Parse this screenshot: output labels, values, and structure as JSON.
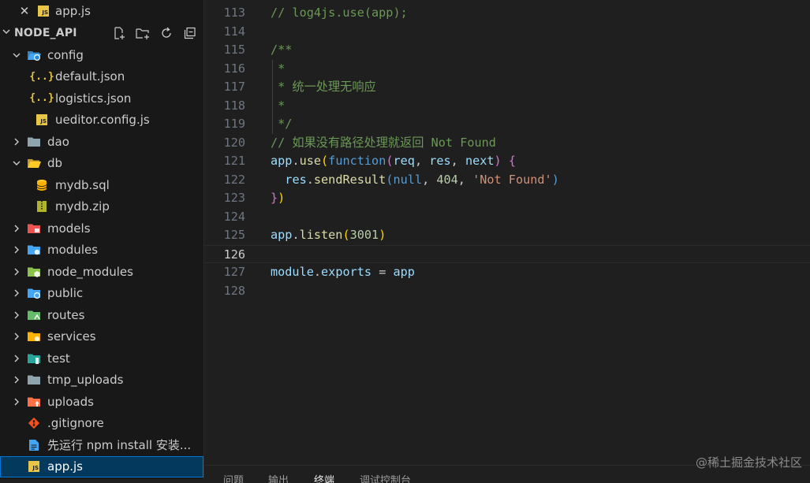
{
  "open_editor": {
    "close_glyph": "✕",
    "file_badge": "JS",
    "file_name": "app.js"
  },
  "explorer": {
    "title": "NODE_API",
    "actions": [
      "new-file-icon",
      "new-folder-icon",
      "refresh-icon",
      "collapse-all-icon"
    ]
  },
  "tree": [
    {
      "name": "config",
      "type": "folder",
      "expanded": true,
      "icon": "folder-config-icon",
      "color": "#42a5f5",
      "depth": 0
    },
    {
      "name": "default.json",
      "type": "file",
      "icon": "json-icon",
      "depth": 1
    },
    {
      "name": "logistics.json",
      "type": "file",
      "icon": "json-icon",
      "depth": 1
    },
    {
      "name": "ueditor.config.js",
      "type": "file",
      "icon": "js-icon",
      "depth": 1
    },
    {
      "name": "dao",
      "type": "folder",
      "expanded": false,
      "icon": "folder-icon",
      "color": "#90a4ae",
      "depth": 0
    },
    {
      "name": "db",
      "type": "folder",
      "expanded": true,
      "icon": "folder-db-icon",
      "color": "#ffca28",
      "depth": 0
    },
    {
      "name": "mydb.sql",
      "type": "file",
      "icon": "database-icon",
      "depth": 1
    },
    {
      "name": "mydb.zip",
      "type": "file",
      "icon": "zip-icon",
      "depth": 1
    },
    {
      "name": "models",
      "type": "folder",
      "expanded": false,
      "icon": "folder-models-icon",
      "color": "#ef5350",
      "depth": 0
    },
    {
      "name": "modules",
      "type": "folder",
      "expanded": false,
      "icon": "folder-modules-icon",
      "color": "#42a5f5",
      "depth": 0
    },
    {
      "name": "node_modules",
      "type": "folder",
      "expanded": false,
      "icon": "folder-node-icon",
      "color": "#8bc34a",
      "depth": 0
    },
    {
      "name": "public",
      "type": "folder",
      "expanded": false,
      "icon": "folder-public-icon",
      "color": "#42a5f5",
      "depth": 0
    },
    {
      "name": "routes",
      "type": "folder",
      "expanded": false,
      "icon": "folder-routes-icon",
      "color": "#66bb6a",
      "depth": 0
    },
    {
      "name": "services",
      "type": "folder",
      "expanded": false,
      "icon": "folder-services-icon",
      "color": "#ffb300",
      "depth": 0
    },
    {
      "name": "test",
      "type": "folder",
      "expanded": false,
      "icon": "folder-test-icon",
      "color": "#26a69a",
      "depth": 0
    },
    {
      "name": "tmp_uploads",
      "type": "folder",
      "expanded": false,
      "icon": "folder-icon",
      "color": "#90a4ae",
      "depth": 0
    },
    {
      "name": "uploads",
      "type": "folder",
      "expanded": false,
      "icon": "folder-uploads-icon",
      "color": "#ff7043",
      "depth": 0
    },
    {
      "name": ".gitignore",
      "type": "file",
      "icon": "git-icon",
      "depth": 0
    },
    {
      "name": "先运行 npm install 安装...",
      "type": "file",
      "icon": "document-icon",
      "depth": 0
    },
    {
      "name": "app.js",
      "type": "file",
      "icon": "js-icon",
      "depth": 0,
      "selected": true
    }
  ],
  "editor": {
    "lines": [
      {
        "n": "113",
        "tokens": [
          [
            "c-comment",
            "// log4js.use(app);"
          ]
        ]
      },
      {
        "n": "114",
        "tokens": []
      },
      {
        "n": "115",
        "tokens": [
          [
            "c-comment",
            "/**"
          ]
        ]
      },
      {
        "n": "116",
        "tokens": [
          [
            "c-comment",
            " *"
          ]
        ]
      },
      {
        "n": "117",
        "tokens": [
          [
            "c-comment",
            " * 统一处理无响应"
          ]
        ]
      },
      {
        "n": "118",
        "tokens": [
          [
            "c-comment",
            " *"
          ]
        ]
      },
      {
        "n": "119",
        "tokens": [
          [
            "c-comment",
            " */"
          ]
        ]
      },
      {
        "n": "120",
        "tokens": [
          [
            "c-comment",
            "// 如果没有路径处理就返回 Not Found"
          ]
        ]
      },
      {
        "n": "121",
        "tokens": [
          [
            "c-var",
            "app"
          ],
          [
            "c-punc",
            "."
          ],
          [
            "c-fn",
            "use"
          ],
          [
            "c-brace",
            "("
          ],
          [
            "c-kw",
            "function"
          ],
          [
            "c-paren",
            "("
          ],
          [
            "c-var",
            "req"
          ],
          [
            "c-punc",
            ", "
          ],
          [
            "c-var",
            "res"
          ],
          [
            "c-punc",
            ", "
          ],
          [
            "c-var",
            "next"
          ],
          [
            "c-paren",
            ")"
          ],
          [
            "c-punc",
            " "
          ],
          [
            "c-paren",
            "{"
          ]
        ]
      },
      {
        "n": "122",
        "tokens": [
          [
            "c-punc",
            "  "
          ],
          [
            "c-var",
            "res"
          ],
          [
            "c-punc",
            "."
          ],
          [
            "c-fn",
            "sendResult"
          ],
          [
            "c-kw",
            "("
          ],
          [
            "c-kw",
            "null"
          ],
          [
            "c-punc",
            ", "
          ],
          [
            "c-num",
            "404"
          ],
          [
            "c-punc",
            ", "
          ],
          [
            "c-str",
            "'Not Found'"
          ],
          [
            "c-kw",
            ")"
          ]
        ]
      },
      {
        "n": "123",
        "tokens": [
          [
            "c-paren",
            "}"
          ],
          [
            "c-brace",
            ")"
          ]
        ]
      },
      {
        "n": "124",
        "tokens": []
      },
      {
        "n": "125",
        "tokens": [
          [
            "c-var",
            "app"
          ],
          [
            "c-punc",
            "."
          ],
          [
            "c-fn",
            "listen"
          ],
          [
            "c-brace",
            "("
          ],
          [
            "c-num",
            "3001"
          ],
          [
            "c-brace",
            ")"
          ]
        ]
      },
      {
        "n": "126",
        "tokens": [],
        "current": true
      },
      {
        "n": "127",
        "tokens": [
          [
            "c-var",
            "module"
          ],
          [
            "c-punc",
            "."
          ],
          [
            "c-var",
            "exports"
          ],
          [
            "c-punc",
            " = "
          ],
          [
            "c-var",
            "app"
          ]
        ]
      },
      {
        "n": "128",
        "tokens": []
      }
    ]
  },
  "panel": {
    "tabs": [
      {
        "label": "问题",
        "active": false
      },
      {
        "label": "输出",
        "active": false
      },
      {
        "label": "终端",
        "active": true
      },
      {
        "label": "调试控制台",
        "active": false
      }
    ]
  },
  "watermark": "@稀土掘金技术社区"
}
